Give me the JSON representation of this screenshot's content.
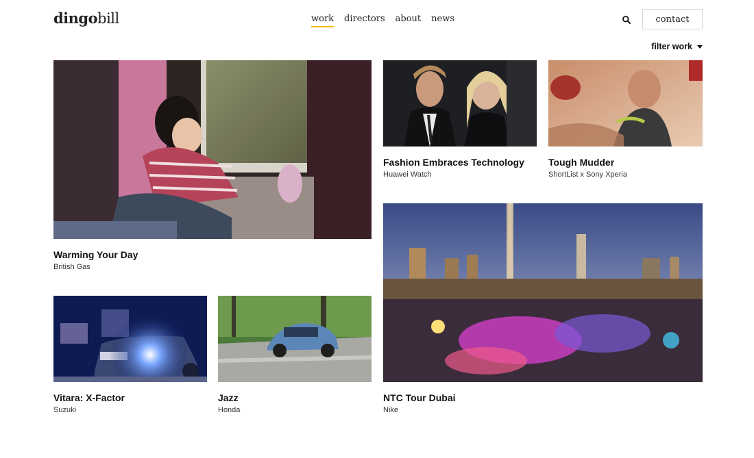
{
  "brand": {
    "logo_part1": "dingo",
    "logo_part2": "bill"
  },
  "nav": {
    "items": [
      {
        "label": "work",
        "active": true
      },
      {
        "label": "directors",
        "active": false
      },
      {
        "label": "about",
        "active": false
      },
      {
        "label": "news",
        "active": false
      }
    ]
  },
  "header": {
    "search_icon": "search-icon",
    "contact_label": "contact"
  },
  "filter": {
    "label": "filter work",
    "icon": "caret-down-icon"
  },
  "accent_color": "#f0b900",
  "projects": [
    {
      "title": "Warming Your Day",
      "client": "British Gas"
    },
    {
      "title": "Fashion Embraces Technology",
      "client": "Huawei Watch"
    },
    {
      "title": "Tough Mudder",
      "client": "ShortList x Sony Xperia"
    },
    {
      "title": "NTC Tour Dubai",
      "client": "Nike"
    },
    {
      "title": "Vitara: X-Factor",
      "client": "Suzuki"
    },
    {
      "title": "Jazz",
      "client": "Honda"
    }
  ]
}
